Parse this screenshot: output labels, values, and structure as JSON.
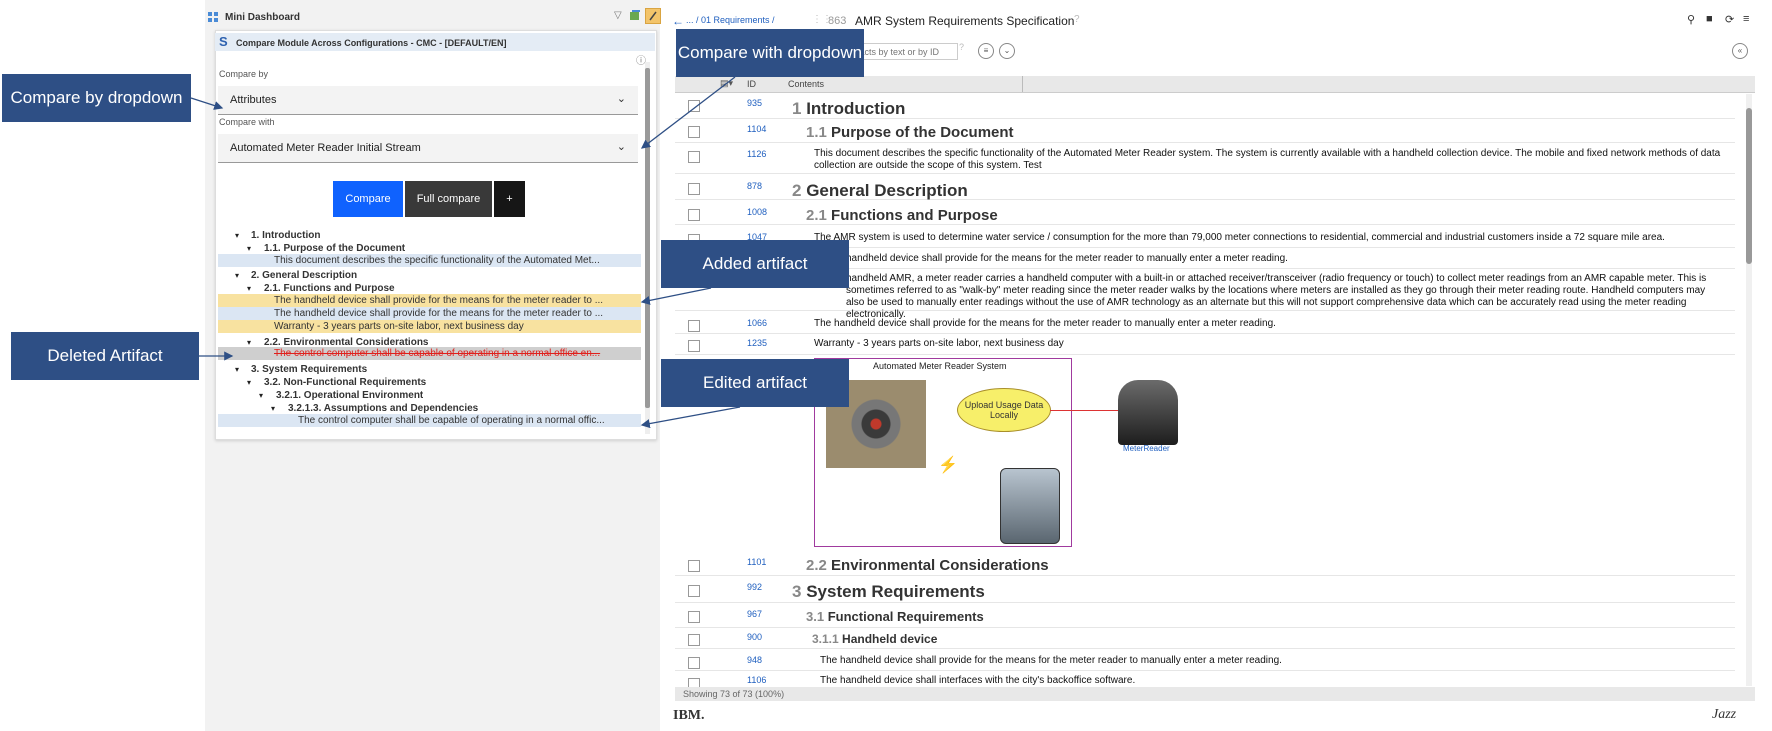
{
  "dashboard": {
    "title": "Mini Dashboard",
    "widget_title": "Compare Module Across Configurations - CMC - [DEFAULT/EN]",
    "compare_by_label": "Compare by",
    "compare_by_value": "Attributes",
    "compare_with_label": "Compare with",
    "compare_with_value": "Automated Meter Reader Initial Stream",
    "buttons": {
      "compare": "Compare",
      "full_compare": "Full compare",
      "plus": "+"
    },
    "tree": [
      {
        "text": "1. Introduction",
        "bold": true
      },
      {
        "text": "1.1. Purpose of the Document",
        "bold": true
      },
      {
        "text": "This document describes the specific functionality of the Automated Met..."
      },
      {
        "text": "2. General Description",
        "bold": true
      },
      {
        "text": "2.1. Functions and Purpose",
        "bold": true
      },
      {
        "text": "The handheld device shall provide for the means for the meter reader to ..."
      },
      {
        "text": "The handheld device shall provide for the means for the meter reader to ..."
      },
      {
        "text": "Warranty - 3 years parts on-site labor, next business day"
      },
      {
        "text": "2.2. Environmental Considerations",
        "bold": true
      },
      {
        "text": "The control computer shall be capable of operating in a normal office en..."
      },
      {
        "text": "3. System Requirements",
        "bold": true
      },
      {
        "text": "3.2. Non-Functional Requirements",
        "bold": true
      },
      {
        "text": "3.2.1. Operational Environment",
        "bold": true
      },
      {
        "text": "3.2.1.3. Assumptions and Dependencies",
        "bold": true
      },
      {
        "text": "The control computer shall be capable of operating in a normal offic..."
      }
    ]
  },
  "callouts": {
    "compare_by": "Compare by dropdown",
    "compare_with": "Compare with dropdown",
    "added": "Added artifact",
    "deleted": "Deleted Artifact",
    "edited": "Edited artifact"
  },
  "module": {
    "breadcrumb": "... / 01 Requirements /",
    "module_id": "863",
    "module_title": "AMR System Requirements Specification",
    "filter_placeholder": "ifacts by text or by ID",
    "col_id": "ID",
    "col_contents": "Contents",
    "rows": [
      {
        "id": "935",
        "num": "1",
        "heading": "Introduction"
      },
      {
        "id": "1104",
        "num": "1.1",
        "heading": "Purpose of the Document"
      },
      {
        "id": "1126",
        "text": "This document describes the specific functionality of the Automated Meter Reader system. The system is currently available with a handheld collection device. The mobile and fixed network methods of data collection are outside the scope of this system. Test"
      },
      {
        "id": "878",
        "num": "2",
        "heading": "General Description"
      },
      {
        "id": "1008",
        "num": "2.1",
        "heading": "Functions and Purpose"
      },
      {
        "id": "1047",
        "text": "The AMR system is used to determine water service / consumption for the more than 79,000 meter connections to residential, commercial and industrial customers inside a 72 square mile area."
      },
      {
        "id": "",
        "text": "handheld device shall provide for the means for the meter reader to manually enter a meter reading."
      },
      {
        "id": "",
        "text": "handheld AMR, a meter reader carries a handheld computer with a built-in or attached receiver/transceiver (radio frequency or touch) to collect meter readings from an AMR capable meter. This is sometimes referred to as \"walk-by\" meter reading since the meter reader walks by the locations where meters are installed as they go through their meter reading route. Handheld computers may also be used to manually enter readings without the use of AMR technology as an alternate but this will not support comprehensive data which can be accurately read using the meter reading electronically."
      },
      {
        "id": "1066",
        "text": "The handheld device shall provide for the means for the meter reader to manually enter a meter reading."
      },
      {
        "id": "1235",
        "text": "Warranty - 3 years parts on-site labor, next business day"
      },
      {
        "id": "1101",
        "num": "2.2",
        "heading": "Environmental Considerations"
      },
      {
        "id": "992",
        "num": "3",
        "heading": "System Requirements"
      },
      {
        "id": "967",
        "num": "3.1",
        "heading": "Functional Requirements"
      },
      {
        "id": "900",
        "num": "3.1.1",
        "heading": "Handheld device"
      },
      {
        "id": "948",
        "text": "The handheld device shall provide for the means for the meter reader to manually enter a meter reading."
      },
      {
        "id": "1106",
        "text": "The handheld device shall interfaces with the city's backoffice software."
      }
    ],
    "diagram_title": "Automated Meter Reader System",
    "diagram_bubble": "Upload Usage Data Locally",
    "diagram_actor": "MeterReader",
    "status": "Showing 73 of 73 (100%)",
    "footer_left": "IBM.",
    "footer_right": "Jazz"
  }
}
